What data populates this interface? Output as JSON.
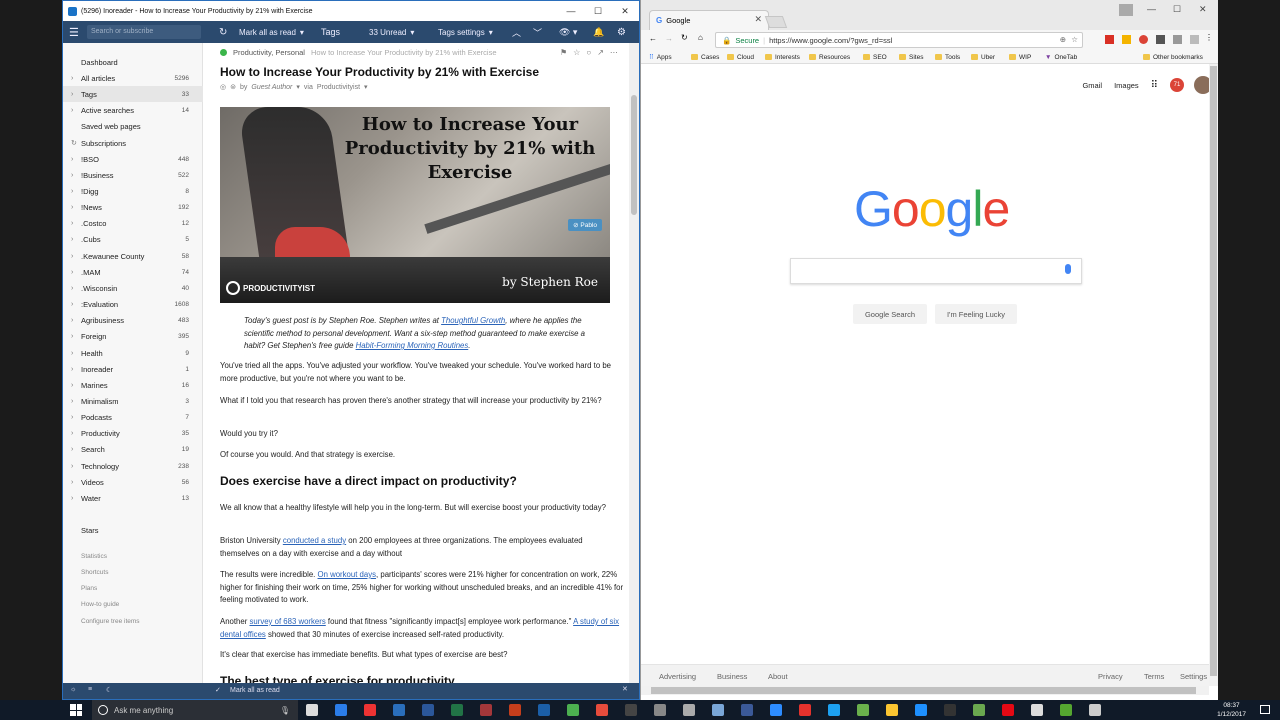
{
  "inoreader": {
    "window_title": "(5296) Inoreader - How to Increase Your Productivity by 21% with Exercise",
    "toolbar": {
      "search_placeholder": "Search or subscribe",
      "mark_all_read": "Mark all as read",
      "tags": "Tags",
      "unread": "33 Unread",
      "tags_settings": "Tags settings"
    },
    "sidebar": [
      {
        "label": "Dashboard",
        "count": ""
      },
      {
        "label": "All articles",
        "count": "5296"
      },
      {
        "label": "Tags",
        "count": "33"
      },
      {
        "label": "Active searches",
        "count": "14"
      },
      {
        "label": "Saved web pages",
        "count": ""
      },
      {
        "label": "Subscriptions",
        "count": ""
      },
      {
        "label": "!BSO",
        "count": "448"
      },
      {
        "label": "!Business",
        "count": "522"
      },
      {
        "label": "!Digg",
        "count": "8"
      },
      {
        "label": "!News",
        "count": "192"
      },
      {
        "label": ".Costco",
        "count": "12"
      },
      {
        "label": ".Cubs",
        "count": "5"
      },
      {
        "label": ".Kewaunee County",
        "count": "58"
      },
      {
        "label": ".MAM",
        "count": "74"
      },
      {
        "label": ".Wisconsin",
        "count": "40"
      },
      {
        "label": ":Evaluation",
        "count": "1608"
      },
      {
        "label": "Agribusiness",
        "count": "483"
      },
      {
        "label": "Foreign",
        "count": "395"
      },
      {
        "label": "Health",
        "count": "9"
      },
      {
        "label": "Inoreader",
        "count": "1"
      },
      {
        "label": "Marines",
        "count": "16"
      },
      {
        "label": "Minimalism",
        "count": "3"
      },
      {
        "label": "Podcasts",
        "count": "7"
      },
      {
        "label": "Productivity",
        "count": "35"
      },
      {
        "label": "Search",
        "count": "19"
      },
      {
        "label": "Technology",
        "count": "238"
      },
      {
        "label": "Videos",
        "count": "56"
      },
      {
        "label": "Water",
        "count": "13"
      }
    ],
    "sidebar_lower": {
      "stars": "Stars",
      "links": [
        "Statistics",
        "Shortcuts",
        "Plans",
        "How-to guide",
        "Configure tree items"
      ]
    },
    "article": {
      "tags": "Productivity, Personal",
      "ghost_title": "How to Increase Your Productivity by 21% with Exercise",
      "title": "How to Increase Your Productivity by 21% with Exercise",
      "by_prefix": "by",
      "author": "Guest Author",
      "via": "via",
      "feed": "Productivityist",
      "hero_headline": "How to Increase Your Productivity by 21% with Exercise",
      "hero_pablo": "Pablo",
      "hero_brand": "PRODUCTIVITYIST",
      "hero_author": "by Stephen Roe",
      "intro": {
        "a": "Today's guest post is by Stephen Roe. Stephen writes at ",
        "link1": "Thoughtful Growth",
        "b": ", where he applies the scientific method to personal development. Want a six-step method guaranteed to make exercise a habit? Get Stephen's free guide ",
        "link2": "Habit-Forming Morning Routines",
        "c": "."
      },
      "p1": "You've tried all the apps. You've adjusted your workflow. You've tweaked your schedule. You've worked hard to be more productive, but you're not where you want to be.",
      "p2": "What if I told you that research has proven there's another strategy that will increase your productivity by 21%?",
      "p3": "Would you try it?",
      "p4": "Of course you would. And that strategy is exercise.",
      "h1": "Does exercise have a direct impact on productivity?",
      "p5": "We all know that a healthy lifestyle will help you in the long-term. But will exercise boost your productivity today?",
      "p6": {
        "a": "Briston University ",
        "link": "conducted a study",
        "b": " on 200 employees at three organizations. The employees evaluated themselves on a day with exercise and a day without"
      },
      "p7": {
        "a": "The results were incredible. ",
        "link": "On workout days",
        "b": ", participants' scores were 21% higher for concentration on work, 22% higher for finishing their work on time, 25% higher for working without unscheduled breaks, and an incredible 41% for feeling motivated to work."
      },
      "p8": {
        "a": "Another ",
        "link1": "survey of 683 workers",
        "b": " found that fitness \"significantly impact[s] employee work performance.\" ",
        "link2": "A study of six dental offices",
        "c": " showed that 30 minutes of exercise increased self-rated productivity."
      },
      "p9": "It's clear that exercise has immediate benefits. But what types of exercise are best?",
      "h2": "The best type of exercise for productivity"
    },
    "bottom": {
      "mark_all_read": "Mark all as read"
    }
  },
  "chrome": {
    "tab_title": "Google",
    "secure": "Secure",
    "url": "https://www.google.com/?gws_rd=ssl",
    "bookmarks": [
      "Apps",
      "Cases",
      "Cloud",
      "Interests",
      "Resources",
      "SEO",
      "Sites",
      "Tools",
      "Uber",
      "WIP",
      "OneTab"
    ],
    "other_bookmarks": "Other bookmarks",
    "top_links": [
      "Gmail",
      "Images"
    ],
    "avatar_badge": "71",
    "logo": [
      "G",
      "o",
      "o",
      "g",
      "l",
      "e"
    ],
    "logo_colors": [
      "#4285F4",
      "#EA4335",
      "#FBBC05",
      "#4285F4",
      "#34A853",
      "#EA4335"
    ],
    "search_button": "Google Search",
    "lucky_button": "I'm Feeling Lucky",
    "footer_left": [
      "Advertising",
      "Business",
      "About"
    ],
    "footer_right": [
      "Privacy",
      "Terms",
      "Settings"
    ]
  },
  "taskbar": {
    "search_placeholder": "Ask me anything",
    "time": "08:37",
    "date": "1/12/2017"
  }
}
